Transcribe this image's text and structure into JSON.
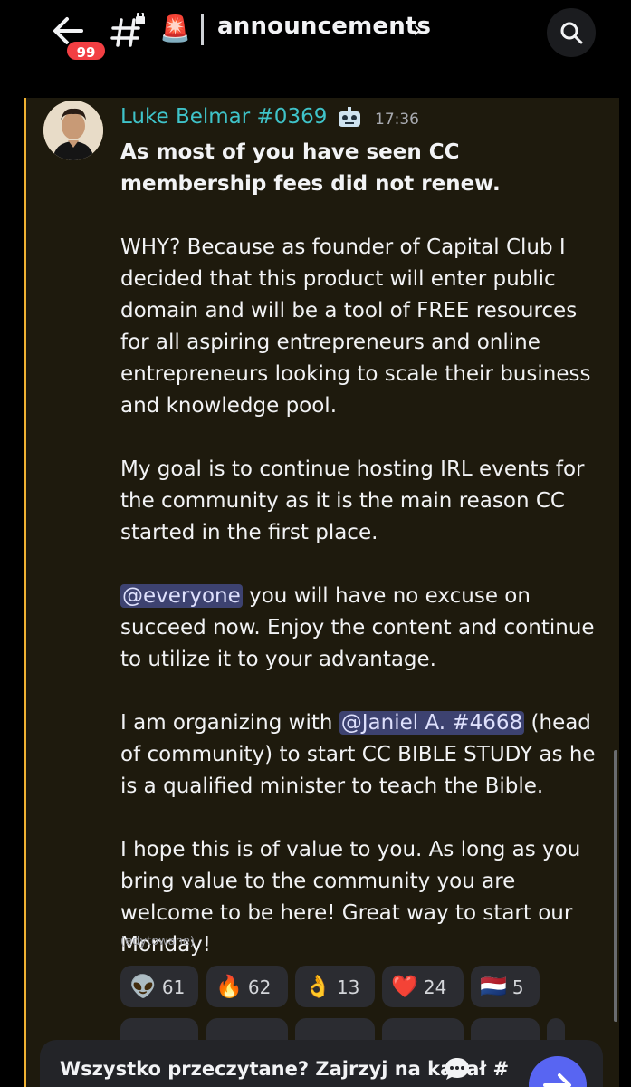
{
  "header": {
    "unread_count": "99",
    "channel_name": "announcements",
    "siren_emoji": "🚨",
    "chevron": "›"
  },
  "message": {
    "author": "Luke Belmar #0369",
    "timestamp": "17:36",
    "headline": "As most of you have seen CC membership fees did not renew.",
    "para1": "WHY? Because as founder of Capital Club I decided that this product will enter public domain and will be a tool of FREE resources for all aspiring entrepreneurs and online entrepreneurs looking to scale their business and knowledge pool.",
    "para2": "My goal is to continue hosting IRL events for the community as it is the main reason CC started in the first place.",
    "para3_mention": "@everyone",
    "para3_rest": " you will have no excuse on succeed now. Enjoy the content and continue to utilize it to your advantage.",
    "para4_pre": "I am organizing with ",
    "para4_mention": "@Janiel A. #4668",
    "para4_rest": " (head of community) to start CC BIBLE STUDY as he is a qualified minister to teach the Bible.",
    "para5": "I hope this is of value to you. As long as you bring value to the community you are welcome to be here! Great way to start our Monday!",
    "edited": "(edytowane)"
  },
  "reactions": [
    {
      "emoji": "👽",
      "count": "61"
    },
    {
      "emoji": "🔥",
      "count": "62"
    },
    {
      "emoji": "👌",
      "count": "13"
    },
    {
      "emoji": "❤️",
      "count": "24"
    },
    {
      "emoji": "🇳🇱",
      "count": "5"
    }
  ],
  "toast": {
    "text": "Wszystko przeczytane? Zajrzyj na kanał #"
  },
  "colors": {
    "accent": "#5865f2",
    "author": "#3fc3c9",
    "highlight_bar": "#f0b232",
    "mention_bg": "#3d4270",
    "badge": "#f23f43"
  }
}
